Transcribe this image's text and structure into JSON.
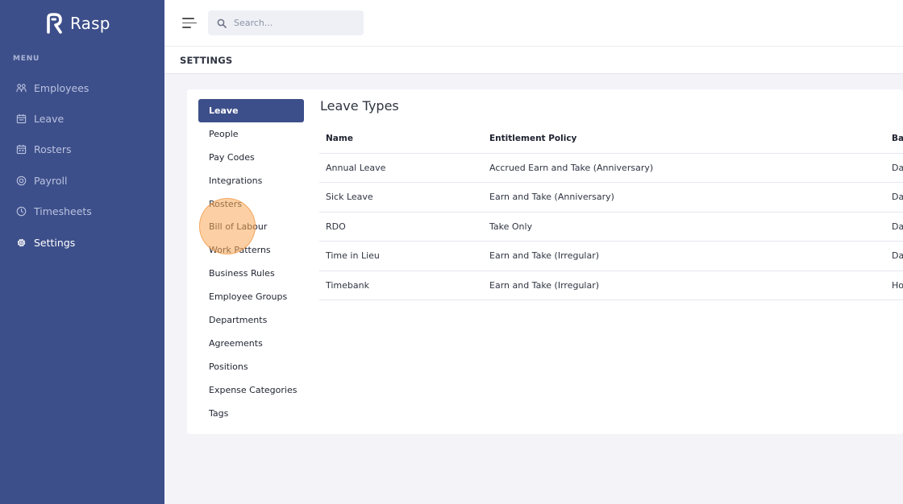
{
  "app": {
    "name": "Rasp"
  },
  "sidebar": {
    "menu_label": "MENU",
    "items": [
      {
        "label": "Employees",
        "icon": "users-icon"
      },
      {
        "label": "Leave",
        "icon": "calendar-icon"
      },
      {
        "label": "Rosters",
        "icon": "calendar-grid-icon"
      },
      {
        "label": "Payroll",
        "icon": "dollar-circle-icon"
      },
      {
        "label": "Timesheets",
        "icon": "clock-icon"
      },
      {
        "label": "Settings",
        "icon": "gear-icon",
        "active": true
      }
    ]
  },
  "topbar": {
    "search_placeholder": "Search..."
  },
  "page": {
    "title": "SETTINGS"
  },
  "settings_nav": {
    "items": [
      {
        "label": "Leave",
        "active": true
      },
      {
        "label": "People"
      },
      {
        "label": "Pay Codes"
      },
      {
        "label": "Integrations"
      },
      {
        "label": "Rosters"
      },
      {
        "label": "Bill of Labour"
      },
      {
        "label": "Work Patterns"
      },
      {
        "label": "Business Rules"
      },
      {
        "label": "Employee Groups"
      },
      {
        "label": "Departments"
      },
      {
        "label": "Agreements"
      },
      {
        "label": "Positions"
      },
      {
        "label": "Expense Categories"
      },
      {
        "label": "Tags"
      }
    ]
  },
  "leave_types": {
    "title": "Leave Types",
    "columns": [
      "Name",
      "Entitlement Policy",
      "Ba"
    ],
    "rows": [
      [
        "Annual Leave",
        "Accrued Earn and Take (Anniversary)",
        "Da"
      ],
      [
        "Sick Leave",
        "Earn and Take (Anniversary)",
        "Da"
      ],
      [
        "RDO",
        "Take Only",
        "Da"
      ],
      [
        "Time in Lieu",
        "Earn and Take (Irregular)",
        "Da"
      ],
      [
        "Timebank",
        "Earn and Take (Irregular)",
        "Ho"
      ]
    ]
  },
  "colors": {
    "sidebar_bg": "#3d4f8a",
    "accent": "#3d4f8a",
    "page_bg": "#f3f3f8",
    "click_highlight": "#faaa5a"
  }
}
